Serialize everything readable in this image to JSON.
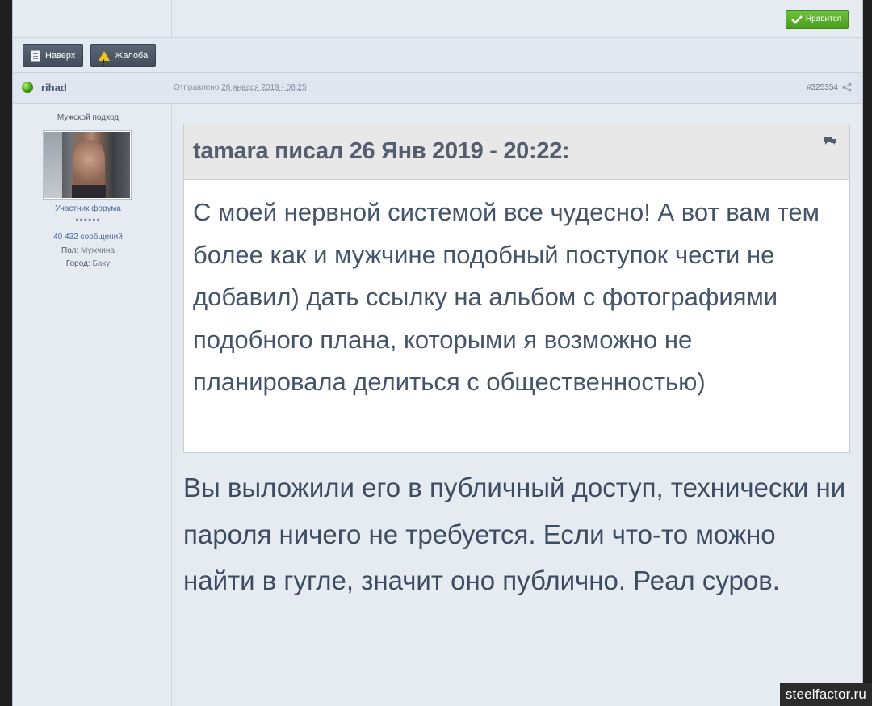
{
  "prev_post": {
    "like_label": "Нравится"
  },
  "actions": {
    "top_label": "Наверх",
    "report_label": "Жалоба"
  },
  "post": {
    "author": "rihad",
    "posted_prefix": "Отправлено",
    "posted_date": "26 января 2019 - 08:25",
    "post_id": "#325354"
  },
  "user": {
    "title": "Мужской подход",
    "group": "Участник форума",
    "rank_pips": "●●●●●●",
    "posts_count": "40 432 сообщений",
    "gender_label": "Пол:",
    "gender_value": "Мужчина",
    "city_label": "Город:",
    "city_value": "Баку"
  },
  "quote": {
    "citation": "tamara писал 26 Янв 2019 - 20:22:",
    "text": "С моей нервной системой все чудесно! А вот вам тем более как и мужчине подобный поступок чести не добавил) дать ссылку на альбом с фотографиями подобного плана, которыми я возможно не планировала делиться с общественностью)"
  },
  "reply": {
    "text": "Вы выложили его в публичный доступ, технически ни пароля ничего не требуется. Если что-то можно найти в гугле, значит оно публично. Реал суров."
  },
  "watermark": "steelfactor.ru",
  "colors": {
    "like_green": "#5aad2a",
    "action_dark": "#4f5868",
    "page_bg": "#e6ebf2"
  },
  "icons": [
    "checkmark-icon",
    "document-icon",
    "warning-icon",
    "status-online-icon",
    "share-icon",
    "quote-icon"
  ]
}
